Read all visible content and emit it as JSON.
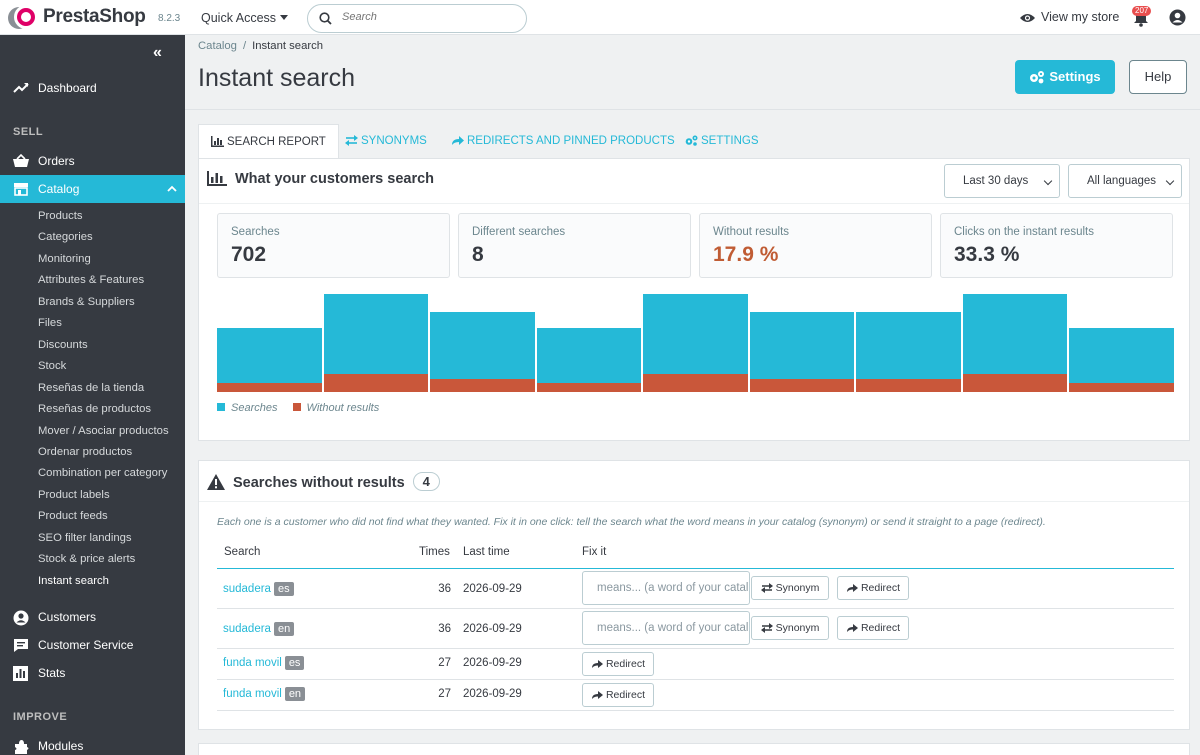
{
  "header": {
    "logo_text": "PrestaShop",
    "version": "8.2.3",
    "quick_access": "Quick Access",
    "search_placeholder": "Search",
    "view_store": "View my store",
    "notifications": "207"
  },
  "sidebar": {
    "collapse": "«",
    "dashboard": "Dashboard",
    "section_sell": "SELL",
    "orders": "Orders",
    "catalog": "Catalog",
    "catalog_items": [
      "Products",
      "Categories",
      "Monitoring",
      "Attributes & Features",
      "Brands & Suppliers",
      "Files",
      "Discounts",
      "Stock",
      "Reseñas de la tienda",
      "Reseñas de productos",
      "Mover / Asociar productos",
      "Ordenar productos",
      "Combination per category",
      "Product labels",
      "Product feeds",
      "SEO filter landings",
      "Stock & price alerts",
      "Instant search"
    ],
    "customers": "Customers",
    "customer_service": "Customer Service",
    "stats": "Stats",
    "section_improve": "IMPROVE",
    "modules": "Modules"
  },
  "breadcrumb": {
    "parent": "Catalog",
    "sep": "/",
    "current": "Instant search"
  },
  "page": {
    "title": "Instant search",
    "settings_button": "Settings",
    "help_button": "Help"
  },
  "tabs": [
    "SEARCH REPORT",
    "SYNONYMS",
    "REDIRECTS AND PINNED PRODUCTS",
    "SETTINGS"
  ],
  "report": {
    "title": "What your customers search",
    "period": "Last 30 days",
    "language": "All languages",
    "kpis": [
      {
        "label": "Searches",
        "value": "702"
      },
      {
        "label": "Different searches",
        "value": "8"
      },
      {
        "label": "Without results",
        "value": "17.9 %"
      },
      {
        "label": "Clicks on the instant results",
        "value": "33.3 %"
      }
    ],
    "legend": {
      "searches": "Searches",
      "without": "Without results"
    }
  },
  "chart_data": {
    "type": "bar",
    "series": [
      {
        "name": "Searches",
        "values": [
          63,
          97,
          79,
          63,
          97,
          79,
          79,
          97,
          63
        ]
      },
      {
        "name": "Without results",
        "values": [
          9,
          18,
          13,
          9,
          18,
          13,
          13,
          18,
          9
        ]
      }
    ],
    "colors": {
      "Searches": "#25b9d7",
      "Without results": "#c9573a"
    },
    "stacked": false,
    "ylim": [
      0,
      97
    ]
  },
  "noresults": {
    "title": "Searches without results",
    "count": "4",
    "hint": "Each one is a customer who did not find what they wanted. Fix it in one click: tell the search what the word means in your catalog (synonym) or send it straight to a page (redirect).",
    "columns": {
      "search": "Search",
      "times": "Times",
      "last": "Last time",
      "fix": "Fix it"
    },
    "placeholder": "means... (a word of your catalog)",
    "synonym_label": "Synonym",
    "redirect_label": "Redirect",
    "rows": [
      {
        "term": "sudadera",
        "lang": "es",
        "times": "36",
        "last": "2026-09-29"
      },
      {
        "term": "sudadera",
        "lang": "en",
        "times": "36",
        "last": "2026-09-29"
      },
      {
        "term": "funda movil",
        "lang": "es",
        "times": "27",
        "last": "2026-09-29"
      },
      {
        "term": "funda movil",
        "lang": "en",
        "times": "27",
        "last": "2026-09-29"
      }
    ]
  }
}
